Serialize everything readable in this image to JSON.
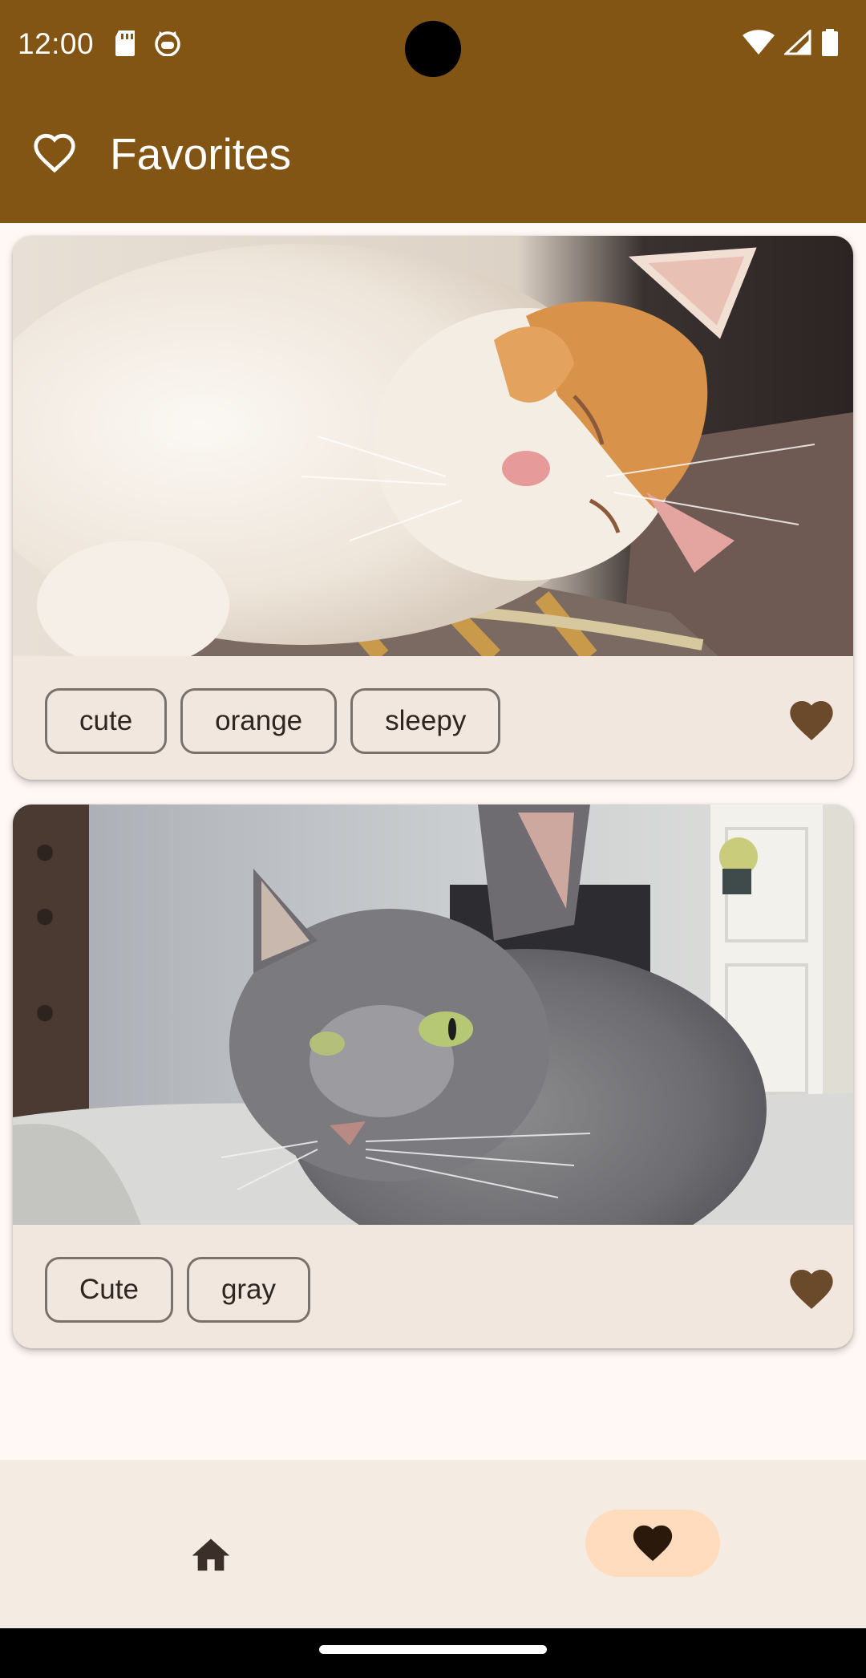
{
  "status_bar": {
    "time": "12:00",
    "left_icons": [
      "sd-card-icon",
      "cat-face-icon"
    ],
    "right_icons": [
      "wifi-icon",
      "cell-signal-icon",
      "battery-icon"
    ]
  },
  "app_bar": {
    "icon": "heart-outline-icon",
    "title": "Favorites"
  },
  "cards": [
    {
      "photo": "cat-photo-white-orange-sleeping",
      "tags": [
        "cute",
        "orange",
        "sleepy"
      ],
      "favorite_icon": "heart-filled-icon"
    },
    {
      "photo": "cat-photo-gray-green-eyes",
      "tags": [
        "Cute",
        "gray"
      ],
      "favorite_icon": "heart-filled-icon"
    }
  ],
  "bottom_nav": {
    "items": [
      {
        "icon": "home-icon",
        "selected": false
      },
      {
        "icon": "heart-filled-icon",
        "selected": true
      }
    ]
  },
  "colors": {
    "app_bar": "#825515",
    "card_background": "#f1e7df",
    "favorite_icon": "#6b4a2b",
    "nav_indicator": "#ffdcbd",
    "page_background": "#fff8f5"
  }
}
